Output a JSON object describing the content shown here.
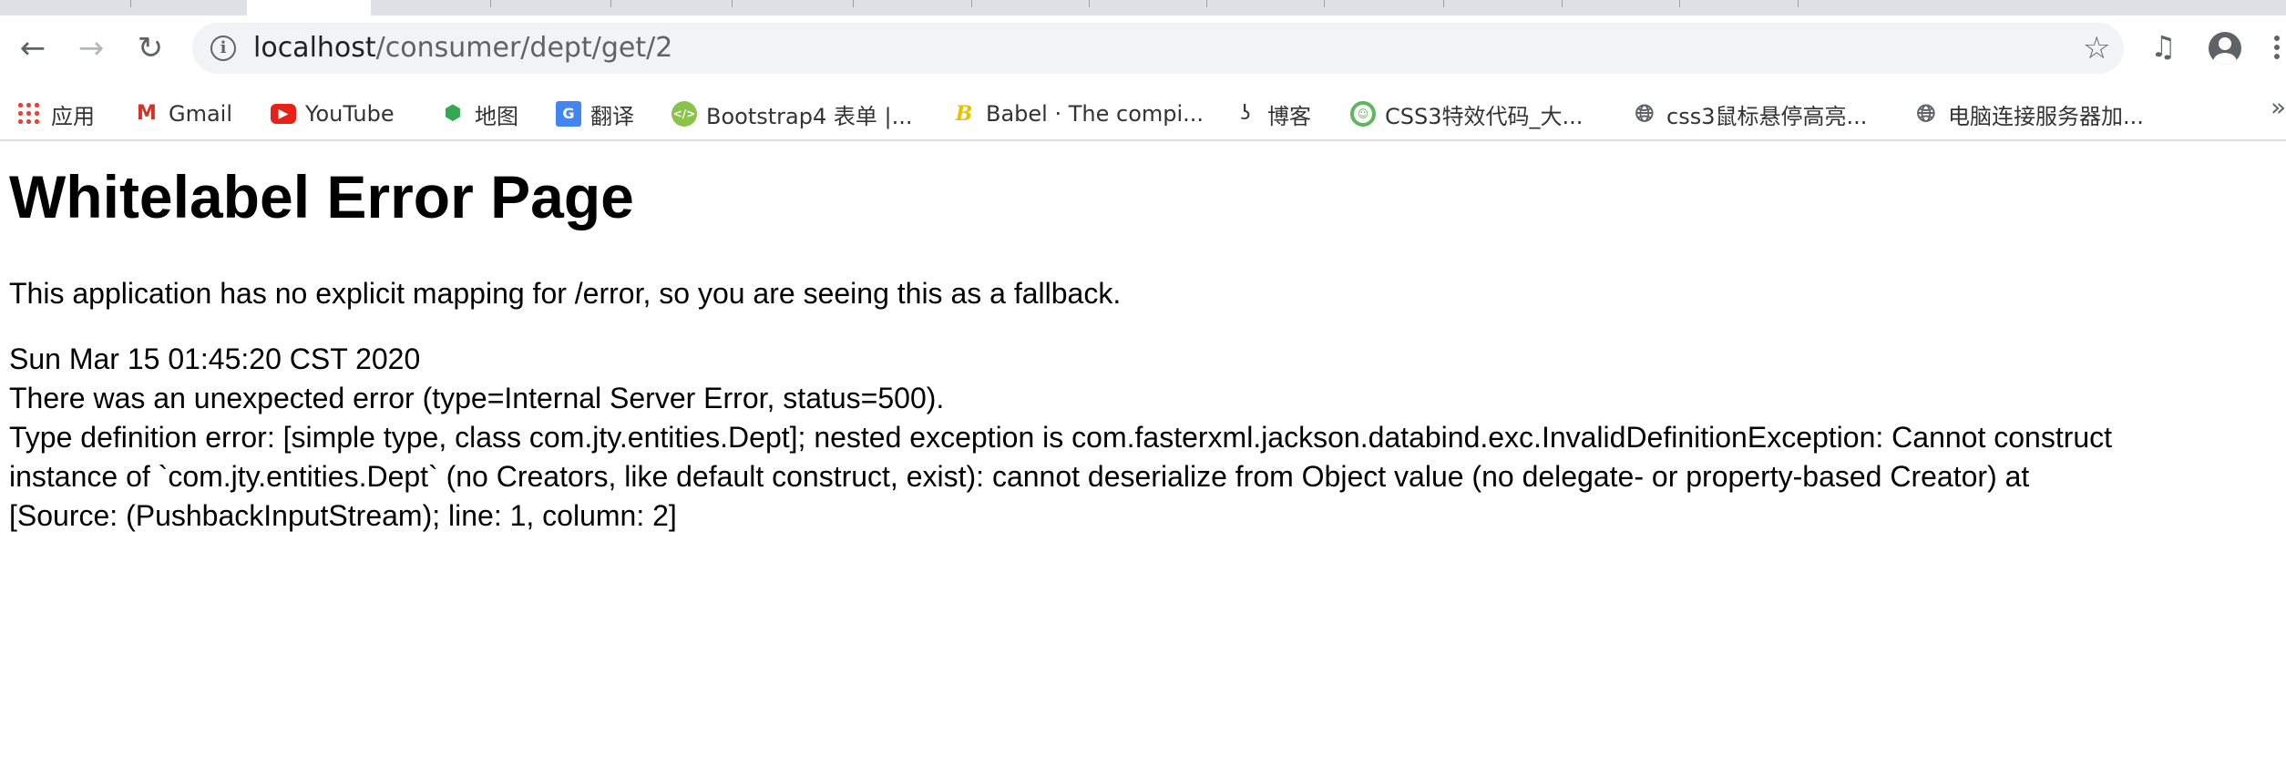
{
  "browser": {
    "url_host": "localhost",
    "url_path": "/consumer/dept/get/2",
    "icons": {
      "back": "arrow-left",
      "forward": "arrow-right",
      "reload": "reload",
      "info": "info-circle",
      "star": "star-outline",
      "media": "media-queue",
      "profile": "account-circle",
      "menu": "vertical-dots"
    },
    "bookmarks": [
      {
        "label": "应用",
        "icon": "apps-grid"
      },
      {
        "label": "Gmail",
        "icon": "gmail"
      },
      {
        "label": "YouTube",
        "icon": "youtube"
      },
      {
        "label": "地图",
        "icon": "maps"
      },
      {
        "label": "翻译",
        "icon": "translate"
      },
      {
        "label": "Bootstrap4 表单 |...",
        "icon": "bootstrap-site"
      },
      {
        "label": "Babel · The compi...",
        "icon": "babel"
      },
      {
        "label": "博客",
        "icon": "blog"
      },
      {
        "label": "CSS3特效代码_大...",
        "icon": "css3-site"
      },
      {
        "label": "css3鼠标悬停高亮...",
        "icon": "globe"
      },
      {
        "label": "电脑连接服务器加...",
        "icon": "globe"
      }
    ],
    "overflow": "»"
  },
  "page": {
    "title": "Whitelabel Error Page",
    "intro": "This application has no explicit mapping for /error, so you are seeing this as a fallback.",
    "timestamp": "Sun Mar 15 01:45:20 CST 2020",
    "error_summary": "There was an unexpected error (type=Internal Server Error, status=500).",
    "message_lines": [
      "Type definition error: [simple type, class com.jty.entities.Dept]; nested exception is com.fasterxml.jackson.databind.exc.InvalidDefinitionException: Cannot construct",
      "instance of `com.jty.entities.Dept` (no Creators, like default construct, exist): cannot deserialize from Object value (no delegate- or property-based Creator) at",
      "[Source: (PushbackInputStream); line: 1, column: 2]"
    ]
  }
}
